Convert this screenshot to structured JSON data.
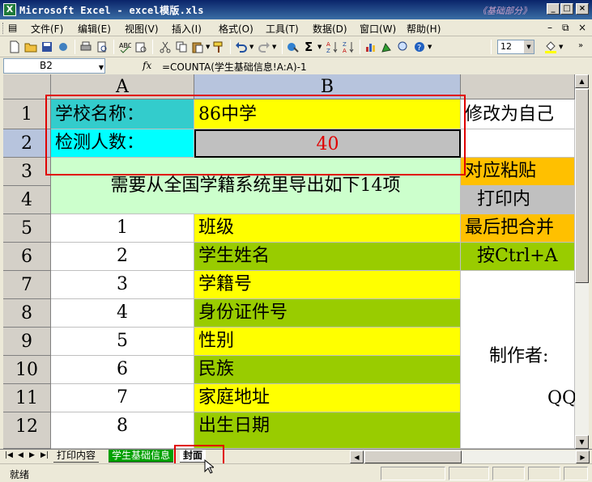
{
  "window": {
    "title": "Microsoft Excel - excel模版.xls",
    "watermark": "《基础部分》"
  },
  "menu": {
    "items": [
      "文件(F)",
      "编辑(E)",
      "视图(V)",
      "插入(I)",
      "格式(O)",
      "工具(T)",
      "数据(D)",
      "窗口(W)",
      "帮助(H)"
    ]
  },
  "toolbar": {
    "font_size": "12"
  },
  "formula_bar": {
    "name_box": "B2",
    "fx": "fx",
    "formula": "=COUNTA(学生基础信息!A:A)-1"
  },
  "grid": {
    "columns": [
      "A",
      "B"
    ],
    "rows": [
      "1",
      "2",
      "3",
      "4",
      "5",
      "6",
      "7",
      "8",
      "9",
      "10",
      "11",
      "12"
    ],
    "school_label": "学校名称：",
    "school_value": "86中学",
    "count_label": "检测人数：",
    "count_value": "40",
    "merged_note": "需要从全国学籍系统里导出如下14项",
    "items": [
      {
        "num": "1",
        "name": "班级"
      },
      {
        "num": "2",
        "name": "学生姓名"
      },
      {
        "num": "3",
        "name": "学籍号"
      },
      {
        "num": "4",
        "name": "身份证件号"
      },
      {
        "num": "5",
        "name": "性别"
      },
      {
        "num": "6",
        "name": "民族"
      },
      {
        "num": "7",
        "name": "家庭地址"
      },
      {
        "num": "8",
        "name": "出生日期"
      }
    ],
    "col_c": {
      "r1": "修改为自己",
      "r3": "对应粘贴",
      "r4": "打印内",
      "r5": "最后把合并",
      "r6": "按Ctrl+A",
      "r9": "制作者:",
      "r11": "QQ"
    }
  },
  "sheet_tabs": [
    "打印内容",
    "学生基础信息",
    "封面"
  ],
  "status": {
    "text": "就绪"
  },
  "colors": {
    "teal": "#33cccc",
    "cyan": "#00ffff",
    "yellow": "#ffff00",
    "green": "#99cc00",
    "mint": "#ccffcc",
    "orange": "#ffc000",
    "gray": "#c0c0c0",
    "red": "#e00000"
  }
}
